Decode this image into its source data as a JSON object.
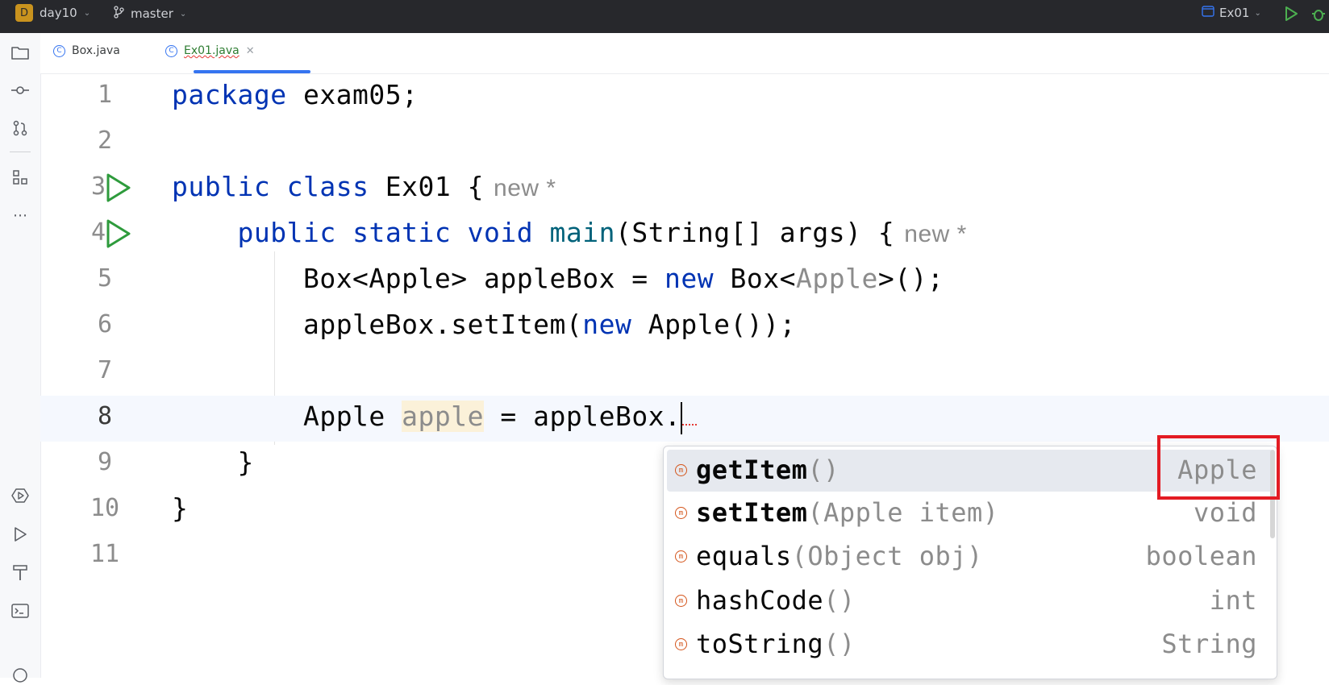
{
  "titlebar": {
    "project_initial": "D",
    "project_name": "day10",
    "branch": "master",
    "run_config": "Ex01"
  },
  "tabs": [
    {
      "label": "Box.java",
      "active": false
    },
    {
      "label": "Ex01.java",
      "active": true
    }
  ],
  "editor": {
    "line_numbers": [
      "1",
      "2",
      "3",
      "4",
      "5",
      "6",
      "7",
      "8",
      "9",
      "10",
      "11"
    ],
    "lines": {
      "l1": {
        "kw": "package",
        "rest": " exam05;"
      },
      "l3": {
        "kw1": "public",
        "kw2": "class",
        "name": " Ex01 {",
        "hint": "new *"
      },
      "l4": {
        "kw1": "public",
        "kw2": "static",
        "kw3": "void",
        "fn": "main",
        "rest": "(String[] args) {",
        "hint": "new *"
      },
      "l5": {
        "a": "Box<Apple> appleBox = ",
        "kw": "new",
        "b": " Box<",
        "gray": "Apple",
        "c": ">();"
      },
      "l6": {
        "a": "appleBox.setItem(",
        "kw": "new",
        "b": " Apple());"
      },
      "l8": {
        "a": "Apple ",
        "var": "apple",
        "b": " = appleBox."
      },
      "l9": {
        "text": "}"
      },
      "l10": {
        "text": "}"
      }
    }
  },
  "completion": {
    "items": [
      {
        "name": "getItem",
        "params": "()",
        "type": "Apple"
      },
      {
        "name": "setItem",
        "params": "(Apple item)",
        "type": "void"
      },
      {
        "name": "equals",
        "params": "(Object obj)",
        "type": "boolean"
      },
      {
        "name": "hashCode",
        "params": "()",
        "type": "int"
      },
      {
        "name": "toString",
        "params": "()",
        "type": "String"
      }
    ]
  },
  "colors": {
    "accent": "#3574f0",
    "highlight_box": "#e31b23",
    "run_green": "#2e9b3c"
  }
}
